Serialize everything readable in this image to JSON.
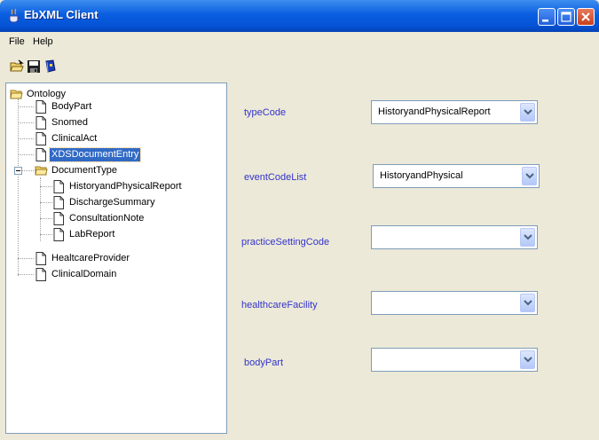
{
  "window": {
    "title": "EbXML Client",
    "title_bar_color": "#0553d6"
  },
  "menu": {
    "items": [
      "File",
      "Help"
    ]
  },
  "toolbar": {
    "icons": [
      "open-folder-icon",
      "save-icon",
      "book-icon"
    ]
  },
  "tree": {
    "root": "Ontology",
    "nodes": [
      "BodyPart",
      "Snomed",
      "ClinicalAct",
      "XDSDocumentEntry",
      "DocumentType",
      "HistoryandPhysicalReport",
      "DischargeSummary",
      "ConsultationNote",
      "LabReport",
      "HealtcareProvider",
      "ClinicalDomain"
    ],
    "selected": "XDSDocumentEntry",
    "selection_color": "#316ac5"
  },
  "form": {
    "label_color": "#3333cc",
    "fields": [
      {
        "label": "typeCode",
        "value": "HistoryandPhysicalReport"
      },
      {
        "label": "eventCodeList",
        "value": "HistoryandPhysical"
      },
      {
        "label": "practiceSettingCode",
        "value": ""
      },
      {
        "label": "healthcareFacility",
        "value": ""
      },
      {
        "label": "bodyPart",
        "value": ""
      }
    ]
  }
}
